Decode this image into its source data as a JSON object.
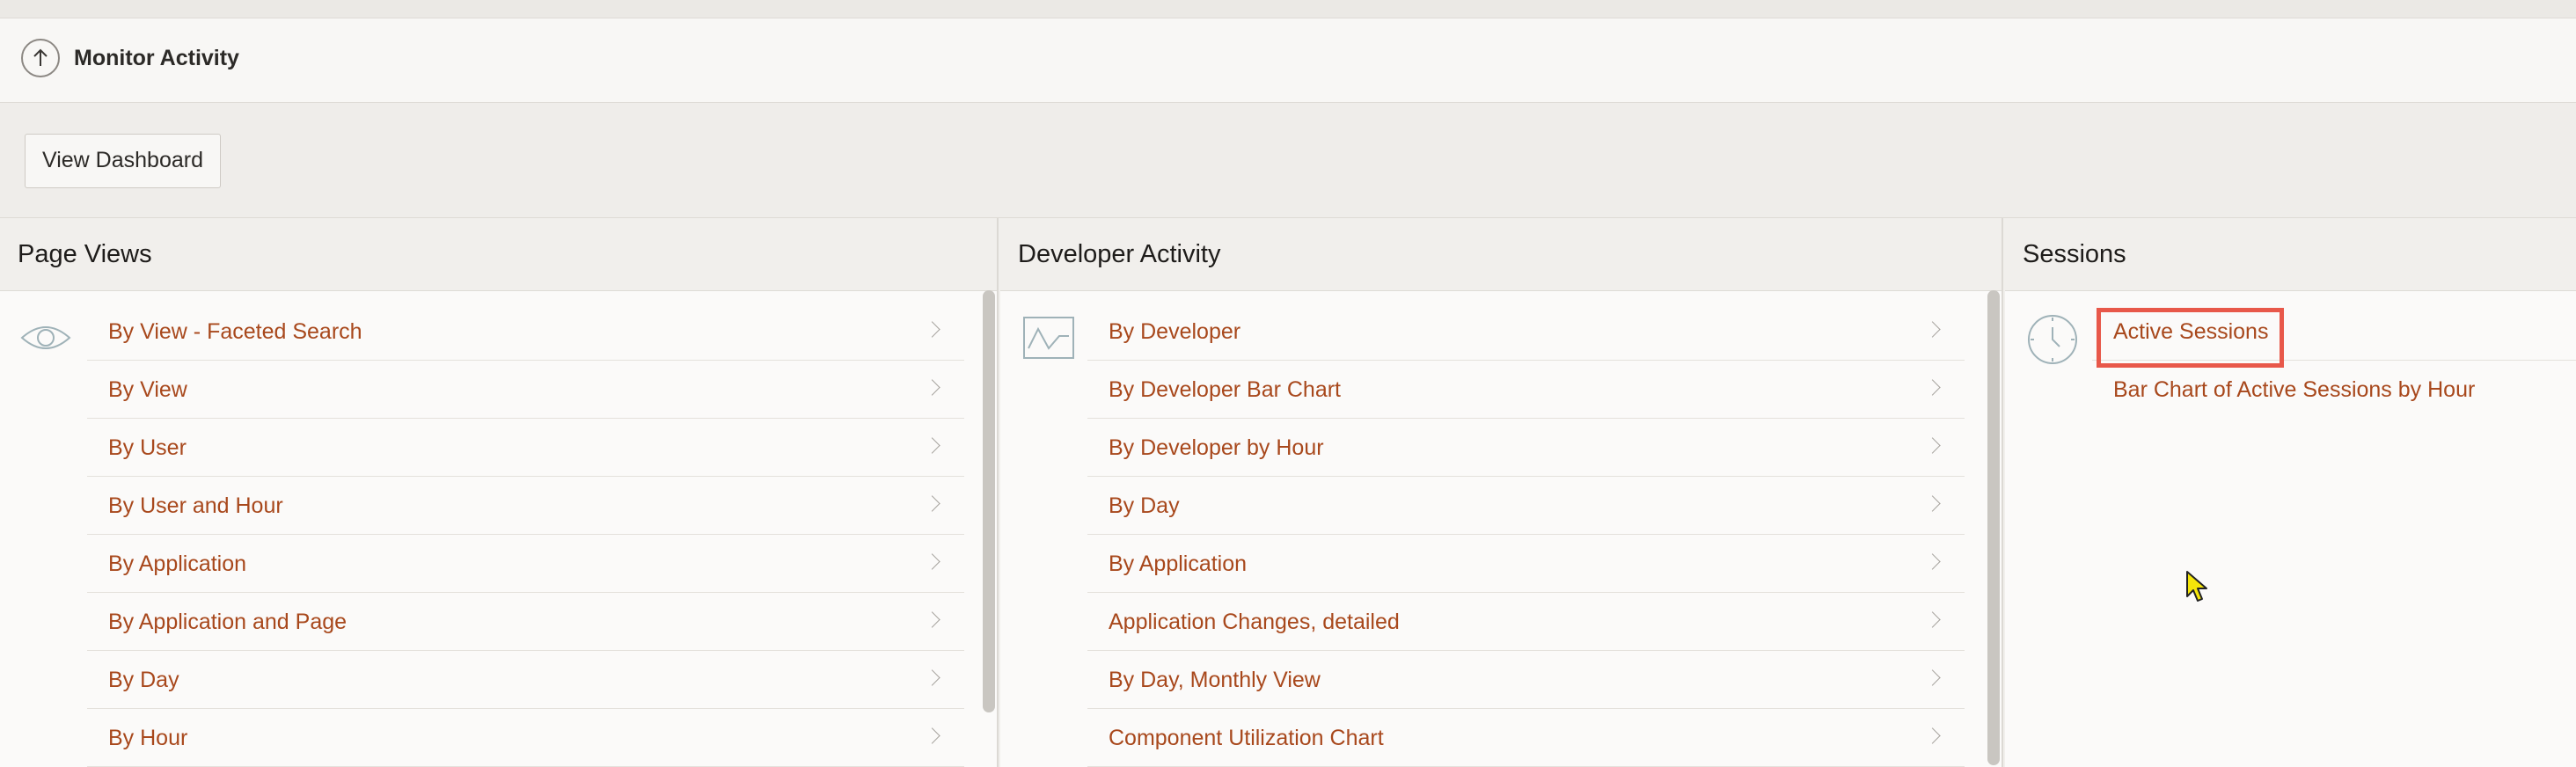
{
  "header": {
    "title": "Monitor Activity",
    "back_icon": "arrow-up-circle-icon"
  },
  "toolbar": {
    "view_dashboard_label": "View Dashboard"
  },
  "panels": [
    {
      "title": "Page Views",
      "icon": "eye-icon",
      "items": [
        "By View - Faceted Search",
        "By View",
        "By User",
        "By User and Hour",
        "By Application",
        "By Application and Page",
        "By Day",
        "By Hour"
      ]
    },
    {
      "title": "Developer Activity",
      "icon": "activity-chart-icon",
      "items": [
        "By Developer",
        "By Developer Bar Chart",
        "By Developer by Hour",
        "By Day",
        "By Application",
        "Application Changes, detailed",
        "By Day, Monthly View",
        "Component Utilization Chart"
      ]
    },
    {
      "title": "Sessions",
      "icon": "clock-icon",
      "items": [
        "Active Sessions",
        "Bar Chart of Active Sessions by Hour"
      ]
    }
  ],
  "colors": {
    "link": "#a8481c",
    "highlight": "#e8584a",
    "cursor": "#f5e60a"
  }
}
